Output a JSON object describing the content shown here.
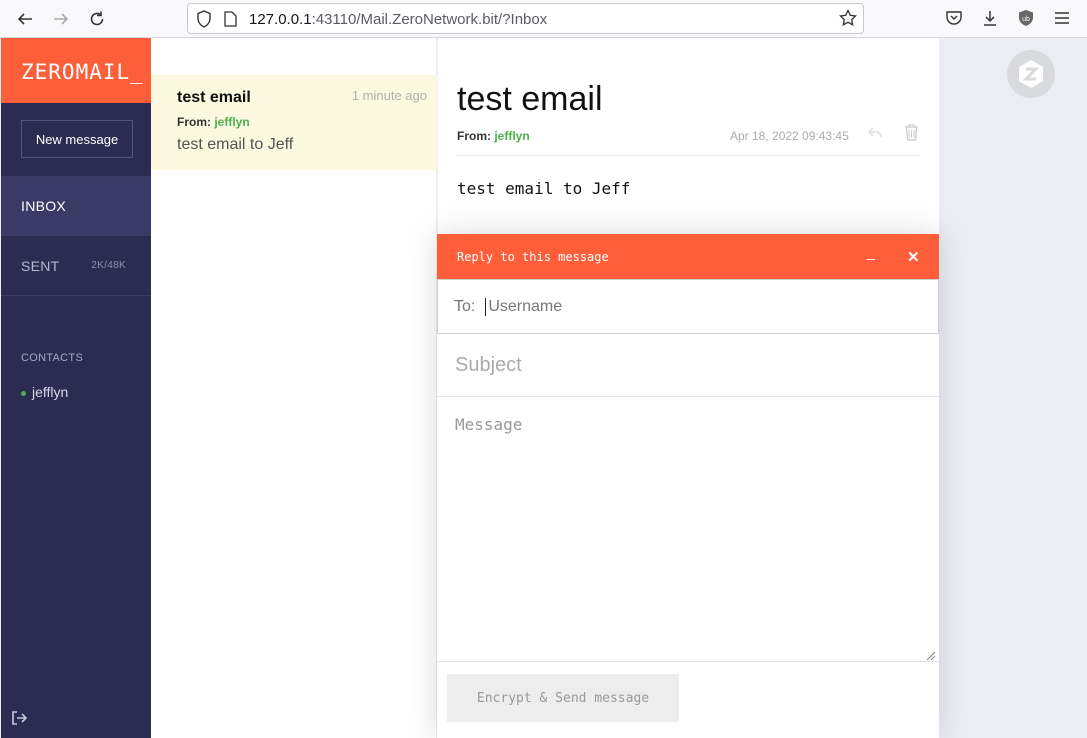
{
  "browser": {
    "url_host": "127.0.0.1",
    "url_rest": ":43110/Mail.ZeroNetwork.bit/?Inbox"
  },
  "sidebar": {
    "logo": "ZEROMAIL_",
    "new_message_label": "New message",
    "nav": [
      {
        "label": "INBOX"
      },
      {
        "label": "SENT",
        "size": "2K/48K"
      }
    ],
    "contacts_heading": "CONTACTS",
    "contacts": [
      "jefflyn"
    ]
  },
  "message_list": {
    "items": [
      {
        "subject": "test email",
        "time": "1 minute ago",
        "from_label": "From:",
        "from": "jefflyn",
        "preview": "test email to Jeff"
      }
    ]
  },
  "reader": {
    "title": "test email",
    "from_label": "From:",
    "from": "jefflyn",
    "date": "Apr 18, 2022 09:43:45",
    "body": "test email to Jeff"
  },
  "composer": {
    "title": "Reply to this message",
    "minimize": "_",
    "close": "✕",
    "to_label": "To:",
    "to_placeholder": "Username",
    "subject_placeholder": "Subject",
    "message_placeholder": "Message",
    "send_label": "Encrypt & Send message"
  },
  "colors": {
    "accent": "#fe5e3a",
    "sidebar": "#2c2b52",
    "contact_online": "#4caf50",
    "selected_row": "#fdf8e0"
  }
}
